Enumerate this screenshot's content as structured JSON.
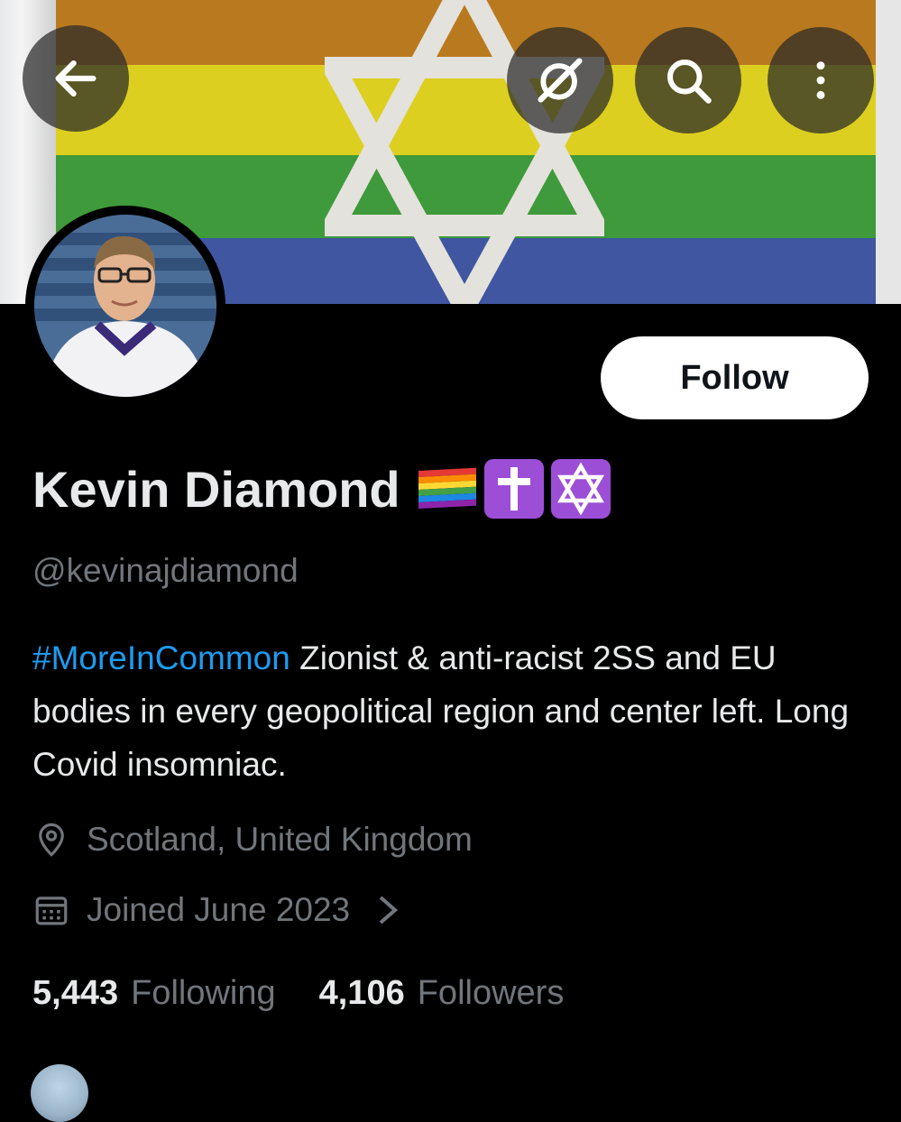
{
  "header": {
    "back_icon": "arrow-left-icon",
    "grok_icon": "grok-icon",
    "search_icon": "search-icon",
    "more_icon": "more-vertical-icon"
  },
  "banner": {
    "description_colors": [
      "#b97a1f",
      "#dccf20",
      "#3e9a3a",
      "#4056a0"
    ],
    "icon": "star-of-david-flag"
  },
  "profile": {
    "display_name": "Kevin Diamond",
    "name_emojis": [
      "rainbow-flag-emoji",
      "latin-cross-emoji",
      "star-of-david-emoji"
    ],
    "handle": "@kevinajdiamond",
    "bio_hashtag": "#MoreInCommon",
    "bio_text": " Zionist & anti-racist 2SS and EU bodies in every geopolitical region and center left. Long Covid insomniac.",
    "location": "Scotland, United Kingdom",
    "joined": "Joined June 2023",
    "follow_label": "Follow"
  },
  "stats": {
    "following_count": "5,443",
    "following_label": "Following",
    "followers_count": "4,106",
    "followers_label": "Followers"
  },
  "colors": {
    "accent": "#1d9bf0",
    "secondary_text": "#71767b",
    "primary_text": "#e7e9ea",
    "background": "#000000"
  }
}
